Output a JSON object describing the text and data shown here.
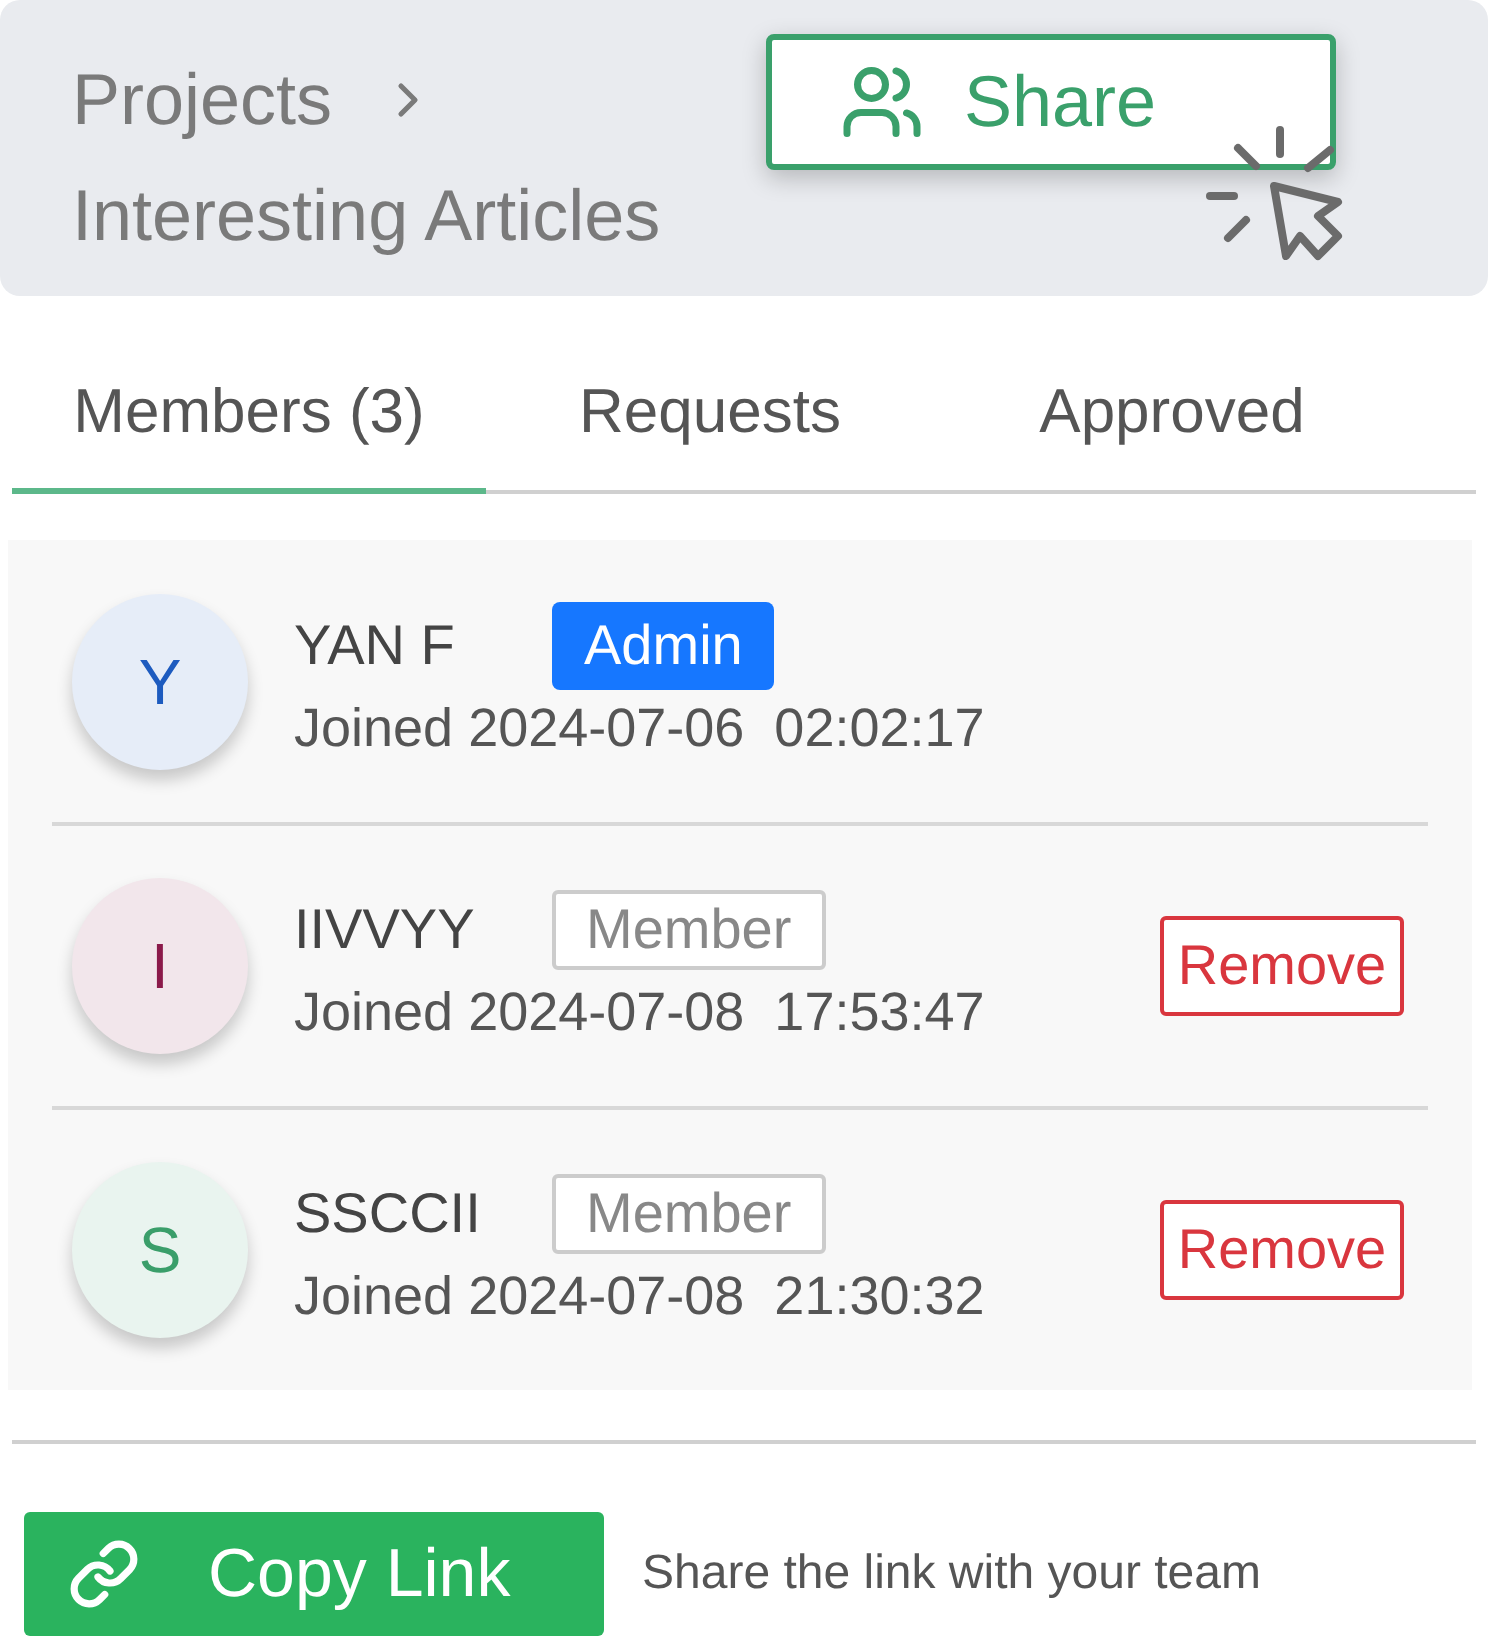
{
  "breadcrumb": {
    "parent": "Projects",
    "current": "Interesting Articles"
  },
  "share_button": {
    "label": "Share"
  },
  "tabs": [
    {
      "label": "Members (3)",
      "selected": true
    },
    {
      "label": "Requests",
      "selected": false
    },
    {
      "label": "Approved",
      "selected": false
    }
  ],
  "members": [
    {
      "initial": "Y",
      "color": "#1d5bbf",
      "name": "YAN F",
      "kind": "admin",
      "role": "Admin",
      "joined": "Joined 2024-07-06  02:02:17"
    },
    {
      "initial": "I",
      "color": "#8b1a4a",
      "name": "IIVVYY",
      "kind": "member",
      "role": "Member",
      "joined": "Joined 2024-07-08  17:53:47",
      "remove": "Remove"
    },
    {
      "initial": "S",
      "color": "#3a9e6a",
      "name": "SSCCII",
      "kind": "member",
      "role": "Member",
      "joined": "Joined 2024-07-08  21:30:32",
      "remove": "Remove"
    }
  ],
  "footer": {
    "copy_button": "Copy Link",
    "hint": "Share the link with your team"
  }
}
